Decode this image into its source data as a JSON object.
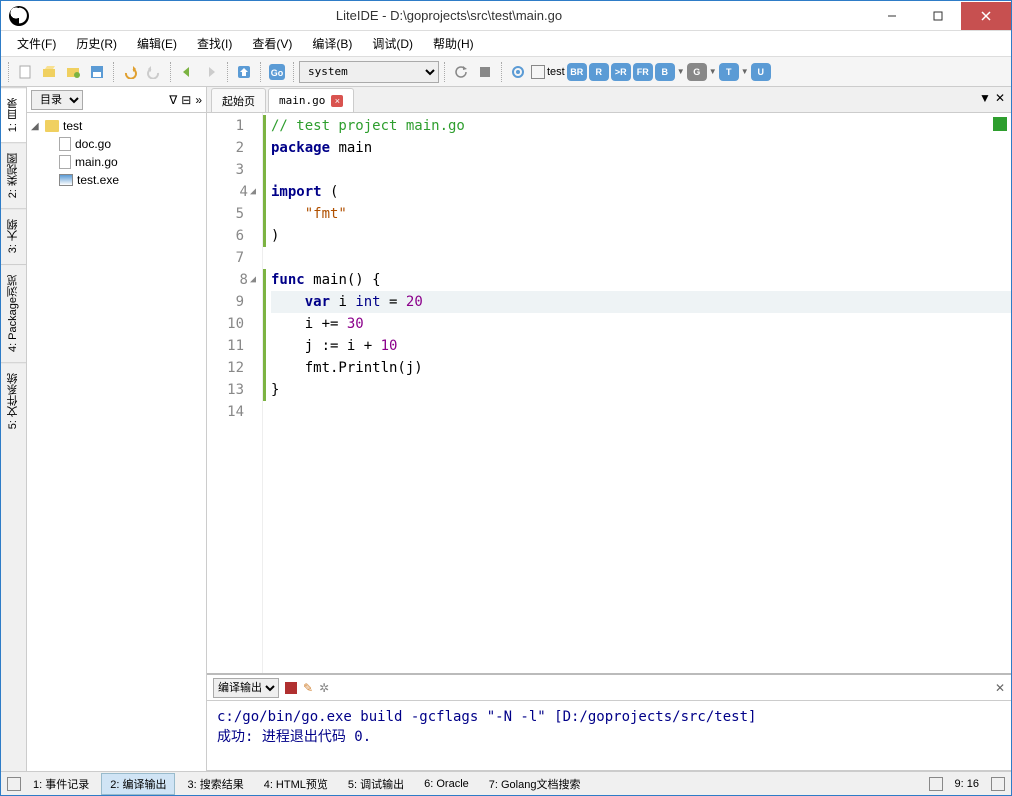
{
  "titlebar": {
    "title": "LiteIDE - D:\\goprojects\\src\\test\\main.go"
  },
  "menu": {
    "items": [
      "文件(F)",
      "历史(R)",
      "编辑(E)",
      "查找(I)",
      "查看(V)",
      "编译(B)",
      "调试(D)",
      "帮助(H)"
    ]
  },
  "toolbar": {
    "env": "system",
    "test_label": "test",
    "badges": [
      "BR",
      "R",
      ">R",
      "FR",
      "B",
      "G",
      "T",
      "U"
    ]
  },
  "left_tabs": [
    "1: 目录",
    "2: 类视图",
    "3: 大纲",
    "4: Package浏览",
    "5: 文件系统"
  ],
  "sidebar": {
    "selector": "目录",
    "tree": {
      "root": "test",
      "children": [
        "doc.go",
        "main.go",
        "test.exe"
      ]
    }
  },
  "tabs": {
    "start": "起始页",
    "file": "main.go"
  },
  "code": {
    "lines": [
      {
        "n": 1,
        "html": "<span class='cm'>// test project main.go</span>"
      },
      {
        "n": 2,
        "html": "<span class='kw'>package</span> main"
      },
      {
        "n": 3,
        "html": ""
      },
      {
        "n": 4,
        "fold": true,
        "html": "<span class='kw'>import</span> ("
      },
      {
        "n": 5,
        "html": "    <span class='str'>\"fmt\"</span>"
      },
      {
        "n": 6,
        "html": ")"
      },
      {
        "n": 7,
        "html": ""
      },
      {
        "n": 8,
        "fold": true,
        "html": "<span class='kw'>func</span> <span class='fn'>main</span>() {"
      },
      {
        "n": 9,
        "hl": true,
        "html": "    <span class='kw'>var</span> i <span class='typ'>int</span> = <span class='num'>20</span>"
      },
      {
        "n": 10,
        "html": "    i += <span class='num'>30</span>"
      },
      {
        "n": 11,
        "html": "    j := i + <span class='num'>10</span>"
      },
      {
        "n": 12,
        "html": "    fmt.Println(j)"
      },
      {
        "n": 13,
        "html": "}"
      },
      {
        "n": 14,
        "html": ""
      }
    ]
  },
  "output": {
    "selector": "编译输出",
    "line1": "c:/go/bin/go.exe build -gcflags \"-N -l\" [D:/goprojects/src/test]",
    "line2": "成功: 进程退出代码 0."
  },
  "status": {
    "tabs": [
      "1: 事件记录",
      "2: 编译输出",
      "3: 搜索结果",
      "4: HTML预览",
      "5: 调试输出",
      "6: Oracle",
      "7: Golang文档搜索"
    ],
    "active": 1,
    "pos": "9: 16"
  }
}
